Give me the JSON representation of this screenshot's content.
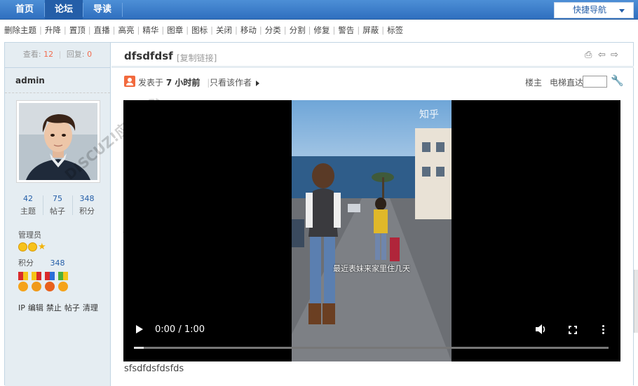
{
  "nav": {
    "items": [
      "首页",
      "论坛",
      "导读"
    ],
    "quick_nav": "快捷导航"
  },
  "mod_actions": [
    "删除主题",
    "升降",
    "置顶",
    "直播",
    "高亮",
    "精华",
    "图章",
    "图标",
    "关闭",
    "移动",
    "分类",
    "分割",
    "修复",
    "警告",
    "屏蔽",
    "标签"
  ],
  "stats": {
    "views_label": "查看:",
    "views": "12",
    "replies_label": "回复:",
    "replies": "0"
  },
  "author": {
    "name": "admin",
    "counts": [
      {
        "value": "42",
        "label": "主题"
      },
      {
        "value": "75",
        "label": "帖子"
      },
      {
        "value": "348",
        "label": "积分"
      }
    ],
    "group": "管理员",
    "credit_label": "积分",
    "credit_value": "348",
    "admin_links": [
      "IP",
      "编辑",
      "禁止",
      "帖子",
      "清理"
    ]
  },
  "thread": {
    "title": "dfsdfdsf",
    "copy_link": "[复制链接]",
    "posted_prefix": "发表于",
    "posted_time": "7 小时前",
    "only_author": "只看该作者",
    "floor": "楼主",
    "jump_label": "电梯直达",
    "body": "sfsdfdsfdsfds"
  },
  "video": {
    "logo": "知乎",
    "subtitle": "最近表妹来家里住几天",
    "time": "0:00 / 1:00",
    "progress": 0.02
  },
  "watermark": {
    "line1": "DISCUZ!应用中心",
    "line2": "addon.discuz.com"
  }
}
